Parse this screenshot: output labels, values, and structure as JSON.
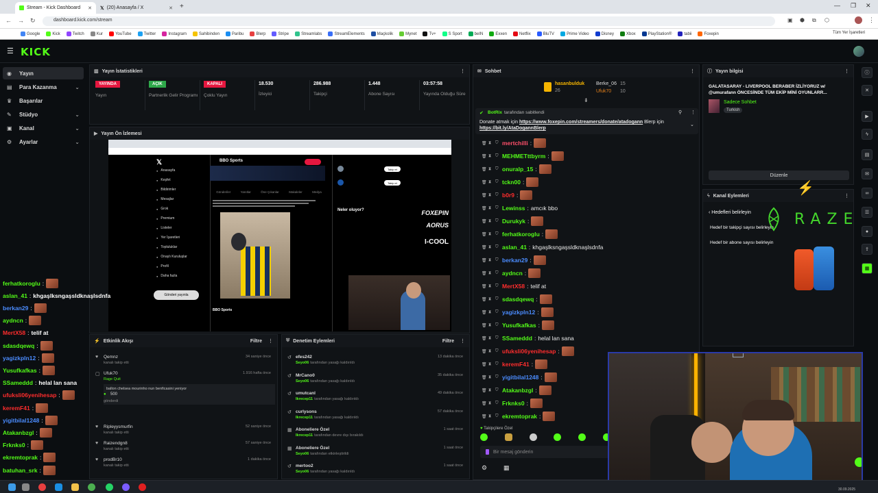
{
  "browser": {
    "tabs": [
      {
        "title": "Stream - Kick Dashboard",
        "active": true
      },
      {
        "title": "(20) Anasayfa / X",
        "active": false
      }
    ],
    "url": "dashboard.kick.com/stream",
    "bookmarks": [
      "Google",
      "Kick",
      "Twitch",
      "Kur",
      "YouTube",
      "Twitter",
      "Instagram",
      "Sahibinden",
      "Paribu",
      "Blerp",
      "Stripe",
      "Streamlabs",
      "StreamElements",
      "Maçkolik",
      "Mynet",
      "Tv+",
      "S Sport",
      "beIN",
      "Exxen",
      "Netflix",
      "BluTV",
      "Prime Video",
      "Disney",
      "Xbox",
      "PlayStation®",
      "tabii",
      "Foxepin"
    ],
    "bookmarks_right": "Tüm Yer İşaretleri"
  },
  "brand": {
    "logo": "KICK",
    "accent": "#53fc18"
  },
  "sidebar": {
    "items": [
      {
        "label": "Yayın",
        "active": true,
        "icon": "broadcast-icon",
        "chevron": false
      },
      {
        "label": "Para Kazanma",
        "active": false,
        "icon": "wallet-icon",
        "chevron": true
      },
      {
        "label": "Başarılar",
        "active": false,
        "icon": "trophy-icon",
        "chevron": false
      },
      {
        "label": "Stüdyo",
        "active": false,
        "icon": "studio-icon",
        "chevron": true
      },
      {
        "label": "Kanal",
        "active": false,
        "icon": "channel-icon",
        "chevron": true
      },
      {
        "label": "Ayarlar",
        "active": false,
        "icon": "gear-icon",
        "chevron": true
      }
    ]
  },
  "stats": {
    "title": "Yayın İstatistikleri",
    "items": [
      {
        "badge": "YAYINDA",
        "badge_color": "#e5173f",
        "label": "Yayın"
      },
      {
        "badge": "AÇIK",
        "badge_color": "#2ea84a",
        "label": "Partnerlik Gelir Programı"
      },
      {
        "badge": "KAPALI",
        "badge_color": "#e5173f",
        "label": "Çoklu Yayın"
      },
      {
        "value": "18.530",
        "label": "İzleyici"
      },
      {
        "value": "286.988",
        "label": "Takipçi"
      },
      {
        "value": "1.448",
        "label": "Abone Sayısı"
      },
      {
        "value": "03:57:58",
        "label": "Yayında Olduğu Süre"
      }
    ]
  },
  "preview": {
    "title": "Yayın Ön İzlemesi",
    "profile": "BBO Sports",
    "x_menu": [
      "Anasayfa",
      "Keşfet",
      "Bildirimler",
      "Mesajlar",
      "Grok",
      "Premium",
      "Listeler",
      "Yer İşaretleri",
      "Topluluklar",
      "Onaylı Kuruluşlar",
      "Profil",
      "Daha fazla"
    ],
    "post_button": "Gönderi yayınla",
    "feed_tabs": [
      "Gönderiler",
      "Yanıtlar",
      "Öne Çıkanlar",
      "Makaleler",
      "Medya"
    ],
    "side_heading": "Neler oluyor?",
    "follow_label": "Takip et",
    "logos": [
      "FOXEPIN",
      "AORUS",
      "I-COOL"
    ]
  },
  "activity": {
    "title": "Etkinlik Akışı",
    "filter": "Filtre",
    "rows": [
      {
        "name": "Qemnz",
        "sub": "kanalı takip etti",
        "time": "34 saniye önce"
      },
      {
        "name": "Ufuk70",
        "sub": "Rage Quit",
        "time": "1.916 hafta önce"
      },
      {
        "name": "",
        "sub": "ballon chelsea mourinho nun benficasini yeniyor",
        "time": ""
      },
      {
        "name": "500",
        "sub": "gönderdi",
        "time": ""
      },
      {
        "name": "Ripleyysmurfin",
        "sub": "kanalı takip etti",
        "time": "52 saniye önce"
      },
      {
        "name": "Raizendgn8",
        "sub": "kanalı takip etti",
        "time": "57 saniye önce"
      },
      {
        "name": "prodBr10",
        "sub": "kanalı takip etti",
        "time": "1 dakika önce"
      }
    ]
  },
  "moderation": {
    "title": "Denetim Eylemleri",
    "filter": "Filtre",
    "rows": [
      {
        "name": "efes242",
        "mod": "Seyo06",
        "action": "tarafından yasağı kaldırıldı",
        "time": "13 dakika önce"
      },
      {
        "name": "MrCano0",
        "mod": "Seyo06",
        "action": "tarafından yasağı kaldırıldı",
        "time": "35 dakika önce"
      },
      {
        "name": "umutcanl",
        "mod": "Ikrecep11",
        "action": "tarafından yasağı kaldırıldı",
        "time": "49 dakika önce"
      },
      {
        "name": "curlysons",
        "mod": "Ikrecep11",
        "action": "tarafından yasağı kaldırıldı",
        "time": "57 dakika önce"
      },
      {
        "name": "Aboneliere Özel",
        "mod": "Ikrecep11",
        "action": "tarafından devre dışı bırakıldı",
        "time": "1 saat önce"
      },
      {
        "name": "Aboneliere Özel",
        "mod": "Seyo06",
        "action": "tarafından etkinleştirildi",
        "time": "1 saat önce"
      },
      {
        "name": "mertoo2",
        "mod": "Seyo06",
        "action": "tarafından yasağı kaldırıldı",
        "time": "1 saat önce"
      }
    ]
  },
  "chat": {
    "title": "Sohbet",
    "top_gifters": [
      {
        "name": "hasanbulduk",
        "count": "26"
      },
      {
        "name": "Berke_06",
        "count": "15"
      },
      {
        "name": "Ufuk70",
        "count": "10"
      }
    ],
    "pinned_by": "BotRix",
    "pinned_suffix": "tarafından sabitlendi",
    "pinned_text": "Donate atmak için",
    "pinned_link1": "https://www.foxepin.com/streamers/donate/atadogann",
    "pinned_mid": "Blerp için",
    "pinned_link2": "https://bit.ly/AtaDogannBlerp",
    "messages": [
      {
        "user": "mertchilli",
        "color": "#ff4f6a",
        "text": ""
      },
      {
        "user": "MEHMETttbyrm",
        "color": "#53fc18",
        "text": ""
      },
      {
        "user": "onuralp_15",
        "color": "#53fc18",
        "text": ""
      },
      {
        "user": "tckn00",
        "color": "#53fc18",
        "text": ""
      },
      {
        "user": "b0r9",
        "color": "#ff2d2d",
        "text": ""
      },
      {
        "user": "Lewinss",
        "color": "#53fc18",
        "text": "amcık bbo"
      },
      {
        "user": "Durukyk",
        "color": "#53fc18",
        "text": ""
      },
      {
        "user": "ferhatkoroglu",
        "color": "#53fc18",
        "text": ""
      },
      {
        "user": "aslan_41",
        "color": "#53fc18",
        "text": "khgaşlksngaşsldknaşlsdnfa"
      },
      {
        "user": "berkan29",
        "color": "#4b8cff",
        "text": ""
      },
      {
        "user": "aydncn",
        "color": "#53fc18",
        "text": ""
      },
      {
        "user": "MertX58",
        "color": "#ff2d2d",
        "text": "telif at"
      },
      {
        "user": "sdasdqewq",
        "color": "#53fc18",
        "text": ""
      },
      {
        "user": "yagizkpln12",
        "color": "#4b8cff",
        "text": ""
      },
      {
        "user": "Yusufkafkas",
        "color": "#53fc18",
        "text": ""
      },
      {
        "user": "SSameddd",
        "color": "#53fc18",
        "text": "helal lan sana"
      },
      {
        "user": "ufuksli06yenihesap",
        "color": "#ff2d2d",
        "text": ""
      },
      {
        "user": "keremF41",
        "color": "#ff2d2d",
        "text": ""
      },
      {
        "user": "yigitbilal1248",
        "color": "#4b8cff",
        "text": ""
      },
      {
        "user": "Atakanbzgl",
        "color": "#53fc18",
        "text": ""
      },
      {
        "user": "Frknks0",
        "color": "#53fc18",
        "text": ""
      },
      {
        "user": "ekremtoprak",
        "color": "#53fc18",
        "text": ""
      }
    ],
    "followers_label": "Takipçilere Özel",
    "input_placeholder": "Bir mesaj gönderin"
  },
  "overlay_chat": [
    {
      "user": "ferhatkoroglu",
      "color": "#53fc18",
      "text": ""
    },
    {
      "user": "aslan_41",
      "color": "#53fc18",
      "text": "khgaşlksngaşsldknaşlsdnfa"
    },
    {
      "user": "berkan29",
      "color": "#4b8cff",
      "text": ""
    },
    {
      "user": "aydncn",
      "color": "#53fc18",
      "text": ""
    },
    {
      "user": "MertX58",
      "color": "#ff2d2d",
      "text": "telif at"
    },
    {
      "user": "sdasdqewq",
      "color": "#53fc18",
      "text": ""
    },
    {
      "user": "yagizkpln12",
      "color": "#4b8cff",
      "text": ""
    },
    {
      "user": "Yusufkafkas",
      "color": "#53fc18",
      "text": ""
    },
    {
      "user": "SSameddd",
      "color": "#53fc18",
      "text": "helal lan sana"
    },
    {
      "user": "ufuksli06yenihesap",
      "color": "#ff2d2d",
      "text": ""
    },
    {
      "user": "keremF41",
      "color": "#ff2d2d",
      "text": ""
    },
    {
      "user": "yigitbilal1248",
      "color": "#4b8cff",
      "text": ""
    },
    {
      "user": "Atakanbzgl",
      "color": "#53fc18",
      "text": ""
    },
    {
      "user": "Frknks0",
      "color": "#53fc18",
      "text": ""
    },
    {
      "user": "ekremtoprak",
      "color": "#53fc18",
      "text": ""
    },
    {
      "user": "batuhan_srk",
      "color": "#53fc18",
      "text": ""
    }
  ],
  "stream_info": {
    "title": "Yayın bilgisi",
    "stream_title": "GALATASARAY - LIVERPOOL BERABER İZLİYORUZ w/ @umurafann ÖNCESİNDE TÜM EKİP MİNİ OYUNLARR...",
    "chat_mode": "Sadece Sohbet",
    "language": "Turkish",
    "edit_button": "Düzenle"
  },
  "channel_actions": {
    "title": "Kanal Eylemleri",
    "back_label": "Hedefleri belirleyin",
    "items": [
      "Hedef bir takipçi sayısı belirleyin",
      "Hedef bir abone sayısı belirleyin"
    ],
    "sponsor": "RAZER"
  },
  "taskbar": {
    "date": "30.09.2025"
  }
}
